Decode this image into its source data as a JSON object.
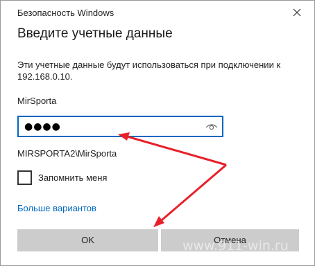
{
  "window": {
    "title": "Безопасность Windows",
    "close_icon": "close-icon"
  },
  "dialog": {
    "heading": "Введите учетные данные",
    "description": "Эти учетные данные будут использоваться при подключении к 192.168.0.10.",
    "username": "MirSporta",
    "password_field": {
      "masked_value": "●●●●",
      "reveal_icon": "eye-icon"
    },
    "domain_user": "MIRSPORTA2\\MirSporta",
    "remember": {
      "label": "Запомнить меня",
      "checked": false
    },
    "more_options_label": "Больше вариантов",
    "ok_label": "OK",
    "cancel_label": "Отмена"
  },
  "overlay": {
    "watermark": "www.911-win.ru",
    "arrow_color": "#e8202a"
  },
  "colors": {
    "accent": "#0067c0",
    "button_bg": "#cccccc"
  }
}
